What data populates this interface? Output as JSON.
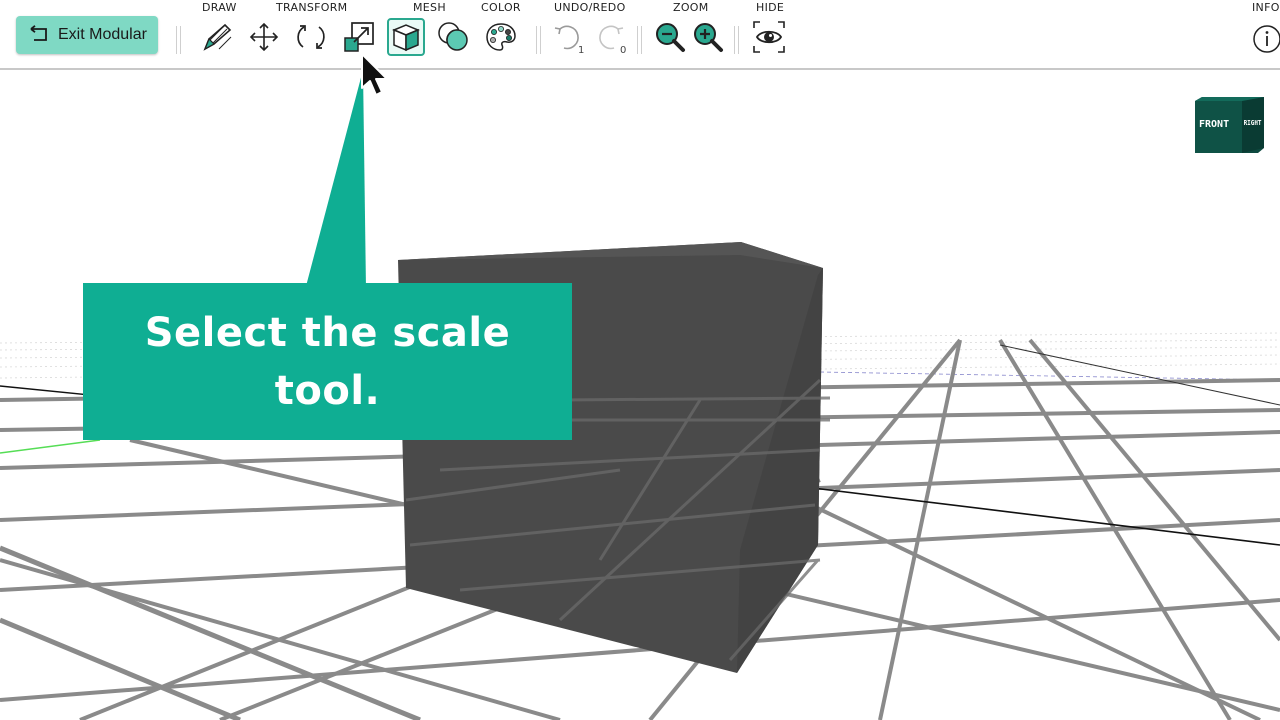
{
  "exit_button": {
    "label": "Exit Modular",
    "icon": "return-arrow-icon"
  },
  "toolbar_groups": {
    "draw": "DRAW",
    "transform": "TRANSFORM",
    "mesh": "MESH",
    "color": "COLOR",
    "undo_redo": "UNDO/REDO",
    "zoom": "ZOOM",
    "hide": "HIDE",
    "info": "INFO"
  },
  "tools": {
    "draw": "pencil-icon",
    "move": "move-arrows-icon",
    "rotate": "rotate-icon",
    "scale": "scale-icon",
    "mesh": "cube-mesh-icon",
    "color_blend": "color-blend-icon",
    "palette": "palette-icon",
    "undo": "undo-icon",
    "redo": "redo-icon",
    "zoom_out": "zoom-out-icon",
    "zoom_in": "zoom-in-icon",
    "hide": "eye-icon",
    "info": "info-icon"
  },
  "undo_count": "1",
  "redo_count": "0",
  "selected_tool": "mesh",
  "view_cube": {
    "front": "FRONT",
    "right": "RIGHT"
  },
  "callout": {
    "text": "Select the scale tool."
  },
  "colors": {
    "accent": "#0fae93",
    "exit_button_bg": "#7fd9c4",
    "cube": "#4a4a4a",
    "view_cube": "#0e4a40"
  }
}
